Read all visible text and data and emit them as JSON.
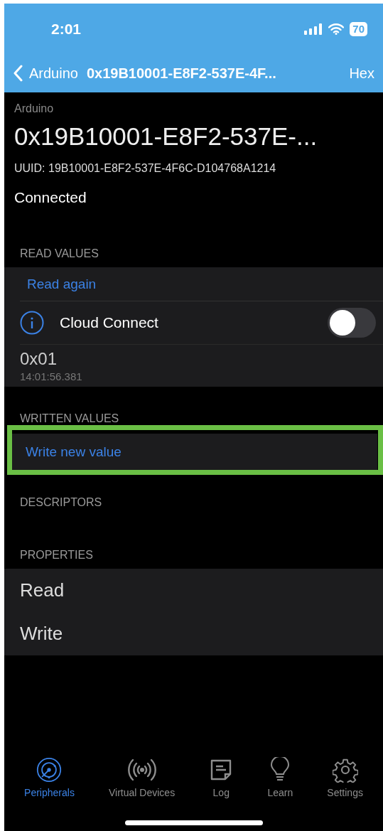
{
  "status_bar": {
    "time": "2:01",
    "battery": "70"
  },
  "nav_bar": {
    "back_label": "Arduino",
    "title": "0x19B10001-E8F2-537E-4F...",
    "action": "Hex"
  },
  "header": {
    "device": "Arduino",
    "title": "0x19B10001-E8F2-537E-...",
    "uuid": "UUID: 19B10001-E8F2-537E-4F6C-D104768A1214",
    "status": "Connected"
  },
  "read_values": {
    "heading": "READ VALUES",
    "action": "Read again",
    "toggle": {
      "label": "Cloud Connect",
      "checked": false
    },
    "value": "0x01",
    "timestamp": "14:01:56.381"
  },
  "written_values": {
    "heading": "WRITTEN VALUES",
    "action": "Write new value",
    "highlighted": true
  },
  "descriptors": {
    "heading": "DESCRIPTORS"
  },
  "properties": {
    "heading": "PROPERTIES",
    "items": [
      "Read",
      "Write"
    ]
  },
  "tab_bar": [
    {
      "kind": "radar",
      "label": "Peripherals",
      "selected": true
    },
    {
      "kind": "broadcast",
      "label": "Virtual Devices",
      "selected": false
    },
    {
      "kind": "log",
      "label": "Log",
      "selected": false
    },
    {
      "kind": "bulb",
      "label": "Learn",
      "selected": false
    },
    {
      "kind": "gear",
      "label": "Settings",
      "selected": false
    }
  ]
}
